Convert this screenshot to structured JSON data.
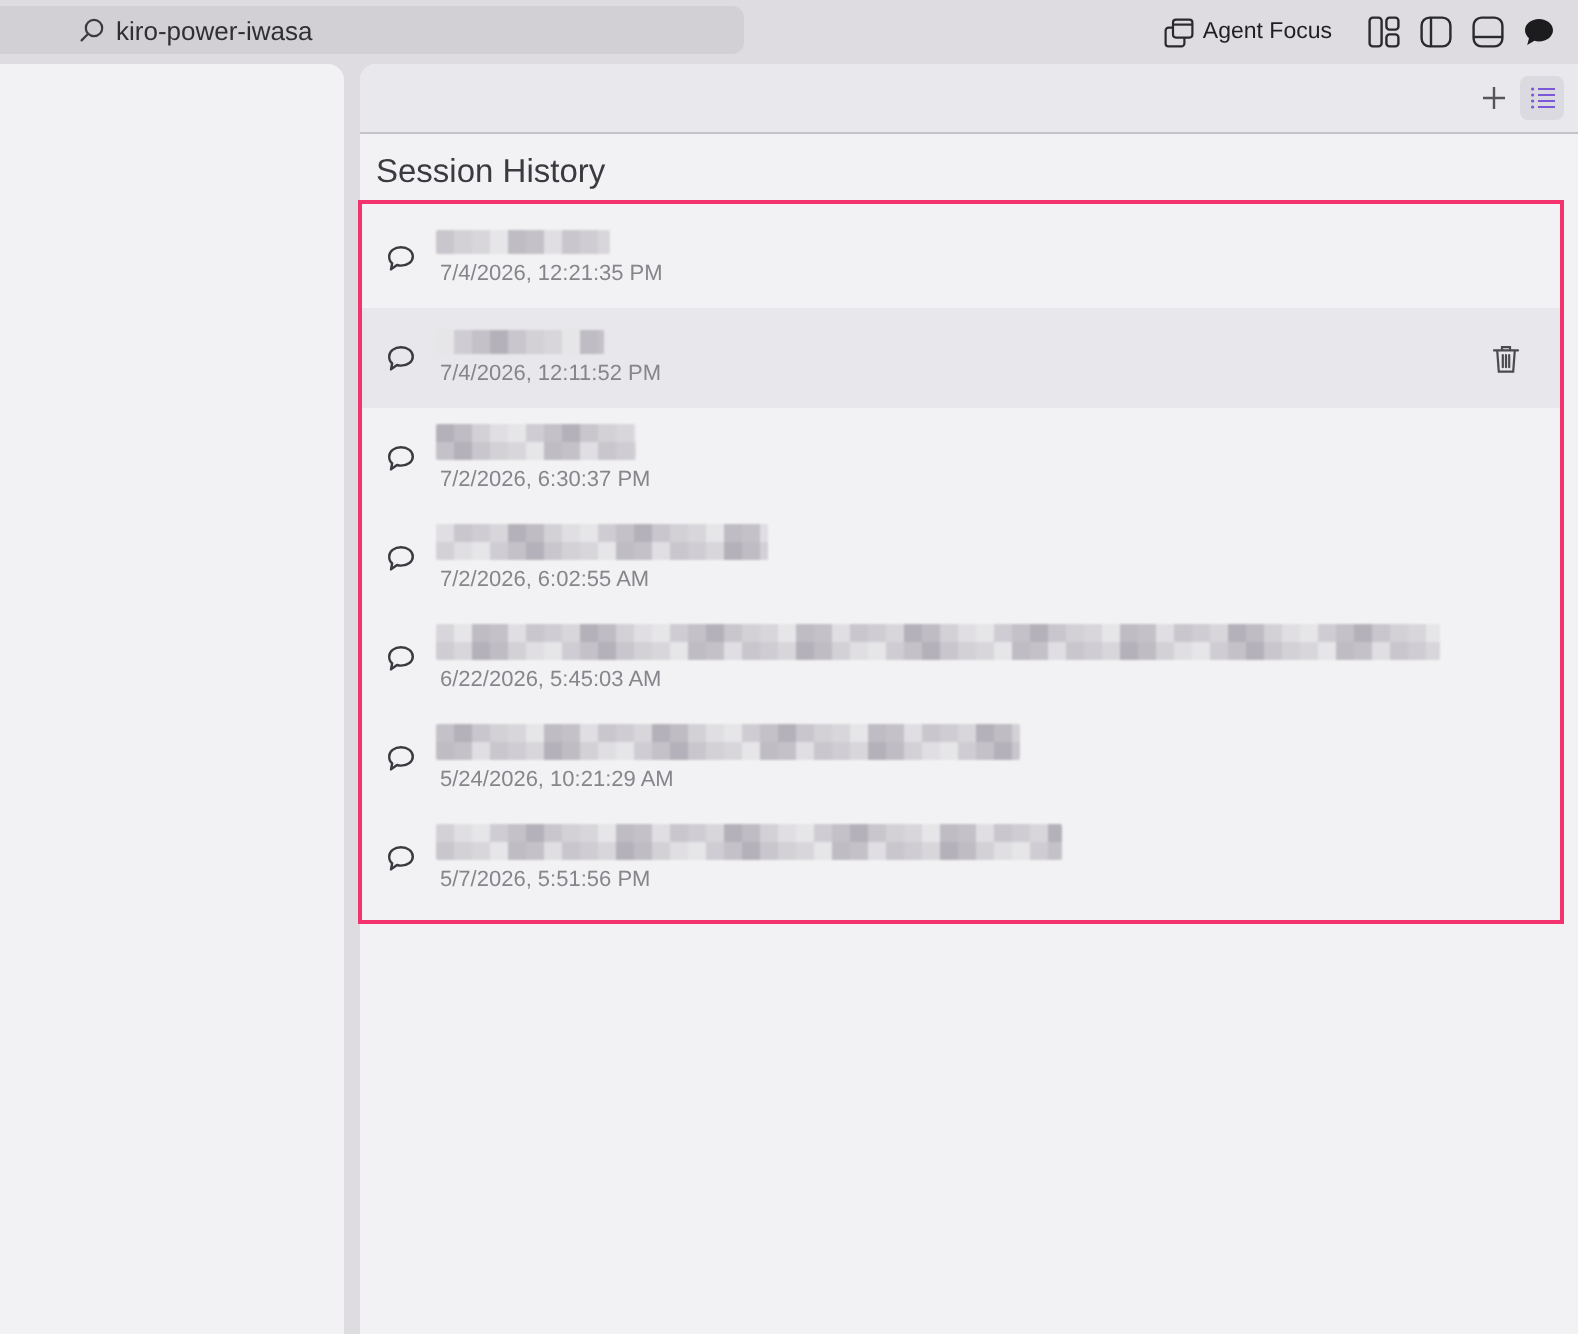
{
  "command_center": {
    "label": "kiro-power-iwasa"
  },
  "title_actions": {
    "agent_focus": "Agent Focus"
  },
  "panel_toolbar": [
    {
      "kind": "new",
      "selected": false
    },
    {
      "kind": "history",
      "selected": true
    }
  ],
  "session_history": {
    "title": "Session History",
    "sessions": [
      {
        "timestamp": "7/4/2026, 12:21:35 PM",
        "selected": false
      },
      {
        "timestamp": "7/4/2026, 12:11:52 PM",
        "selected": true
      },
      {
        "timestamp": "7/2/2026, 6:30:37 PM",
        "selected": false
      },
      {
        "timestamp": "7/2/2026, 6:02:55 AM",
        "selected": false
      },
      {
        "timestamp": "6/22/2026, 5:45:03 AM",
        "selected": false
      },
      {
        "timestamp": "5/24/2026, 10:21:29 AM",
        "selected": false
      },
      {
        "timestamp": "5/7/2026, 5:51:56 PM",
        "selected": false
      }
    ]
  }
}
